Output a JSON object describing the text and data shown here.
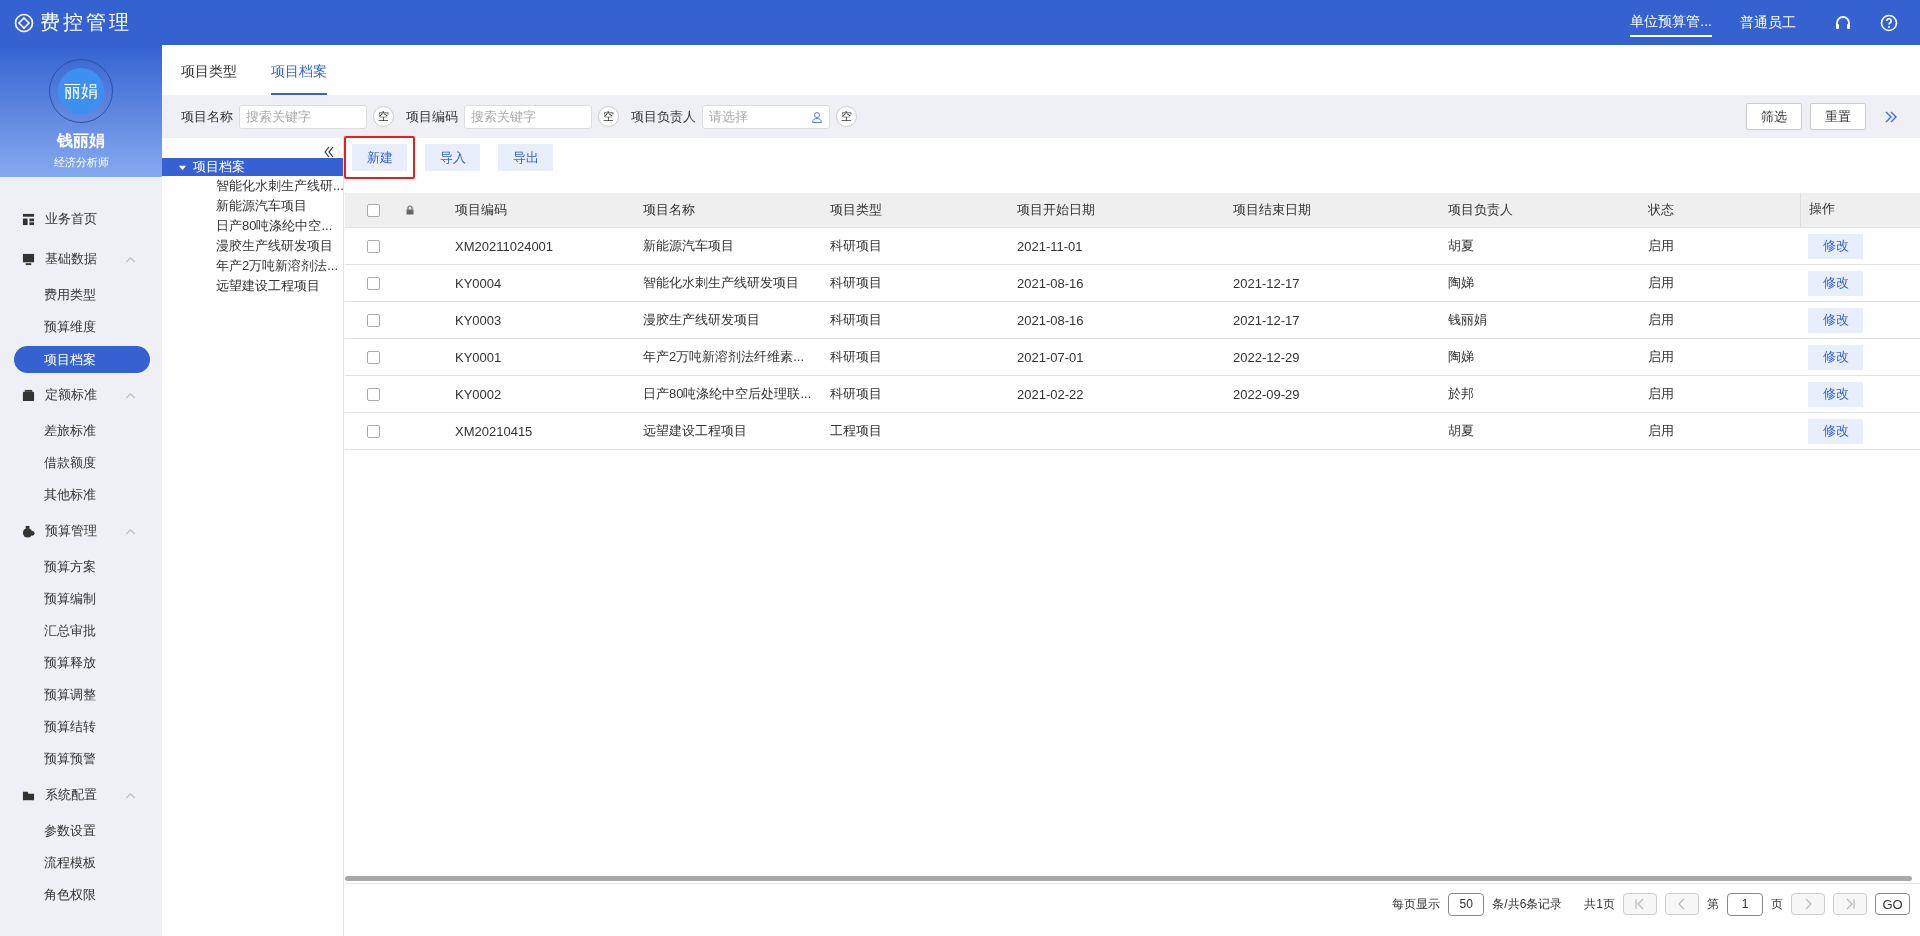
{
  "header": {
    "logo": "费控管理",
    "role": "单位预算管...",
    "user_type": "普通员工"
  },
  "profile": {
    "avatar": "丽娟",
    "name": "钱丽娟",
    "title": "经济分析师"
  },
  "sidebar": [
    {
      "label": "业务首页",
      "kind": "link",
      "selected": false
    },
    {
      "label": "基础数据",
      "kind": "group",
      "expanded": true,
      "children": [
        {
          "label": "费用类型",
          "selected": false
        },
        {
          "label": "预算维度",
          "selected": false
        },
        {
          "label": "项目档案",
          "selected": true
        }
      ]
    },
    {
      "label": "定额标准",
      "kind": "group",
      "expanded": true,
      "children": [
        {
          "label": "差旅标准",
          "selected": false
        },
        {
          "label": "借款额度",
          "selected": false
        },
        {
          "label": "其他标准",
          "selected": false
        }
      ]
    },
    {
      "label": "预算管理",
      "kind": "group",
      "expanded": true,
      "children": [
        {
          "label": "预算方案",
          "selected": false
        },
        {
          "label": "预算编制",
          "selected": false
        },
        {
          "label": "汇总审批",
          "selected": false
        },
        {
          "label": "预算释放",
          "selected": false
        },
        {
          "label": "预算调整",
          "selected": false
        },
        {
          "label": "预算结转",
          "selected": false
        },
        {
          "label": "预算预警",
          "selected": false
        }
      ]
    },
    {
      "label": "系统配置",
      "kind": "group",
      "expanded": true,
      "children": [
        {
          "label": "参数设置",
          "selected": false
        },
        {
          "label": "流程模板",
          "selected": false
        },
        {
          "label": "角色权限",
          "selected": false
        }
      ]
    }
  ],
  "tabs": [
    {
      "label": "项目类型",
      "selected": false
    },
    {
      "label": "项目档案",
      "selected": true
    }
  ],
  "filters": [
    {
      "label": "项目名称",
      "placeholder": "搜索关键字",
      "kind": "text",
      "clear": "空"
    },
    {
      "label": "项目编码",
      "placeholder": "搜索关键字",
      "kind": "text",
      "clear": "空"
    },
    {
      "label": "项目负责人",
      "placeholder": "请选择",
      "kind": "person",
      "clear": "空"
    }
  ],
  "filter_buttons": [
    "筛选",
    "重置"
  ],
  "tree": {
    "label": "项目档案",
    "expanded": true,
    "selected": true,
    "children": [
      {
        "label": "智能化水刺生产线研..."
      },
      {
        "label": "新能源汽车项目"
      },
      {
        "label": "日产80吨涤纶中空..."
      },
      {
        "label": "漫胶生产线研发项目"
      },
      {
        "label": "年产2万吨新溶剂法..."
      },
      {
        "label": "远望建设工程项目"
      }
    ]
  },
  "toolbar": [
    {
      "label": "新建",
      "highlighted": true
    },
    {
      "label": "导入",
      "highlighted": false
    },
    {
      "label": "导出",
      "highlighted": false
    }
  ],
  "table": {
    "all_checked": false,
    "columns": [
      "项目编码",
      "项目名称",
      "项目类型",
      "项目开始日期",
      "项目结束日期",
      "项目负责人",
      "状态",
      "操作"
    ],
    "rows": [
      {
        "checked": false,
        "cells": [
          "XM20211024001",
          "新能源汽车项目",
          "科研项目",
          "2021-11-01",
          "",
          "胡夏",
          "启用"
        ],
        "action": "修改"
      },
      {
        "checked": false,
        "cells": [
          "KY0004",
          "智能化水刺生产线研发项目",
          "科研项目",
          "2021-08-16",
          "2021-12-17",
          "陶娣",
          "启用"
        ],
        "action": "修改"
      },
      {
        "checked": false,
        "cells": [
          "KY0003",
          "漫胶生产线研发项目",
          "科研项目",
          "2021-08-16",
          "2021-12-17",
          "钱丽娟",
          "启用"
        ],
        "action": "修改"
      },
      {
        "checked": false,
        "cells": [
          "KY0001",
          "年产2万吨新溶剂法纤维素...",
          "科研项目",
          "2021-07-01",
          "2022-12-29",
          "陶娣",
          "启用"
        ],
        "action": "修改"
      },
      {
        "checked": false,
        "cells": [
          "KY0002",
          "日产80吨涤纶中空后处理联...",
          "科研项目",
          "2021-02-22",
          "2022-09-29",
          "於邦",
          "启用"
        ],
        "action": "修改"
      },
      {
        "checked": false,
        "cells": [
          "XM20210415",
          "远望建设工程项目",
          "工程项目",
          "",
          "",
          "胡夏",
          "启用"
        ],
        "action": "修改"
      }
    ]
  },
  "pagination": {
    "per_page_label": "每页显示",
    "per_page": "50",
    "total": "条/共6条记录",
    "pages": "共1页",
    "page_prefix": "第",
    "page": "1",
    "page_suffix": "页",
    "go": "GO"
  }
}
